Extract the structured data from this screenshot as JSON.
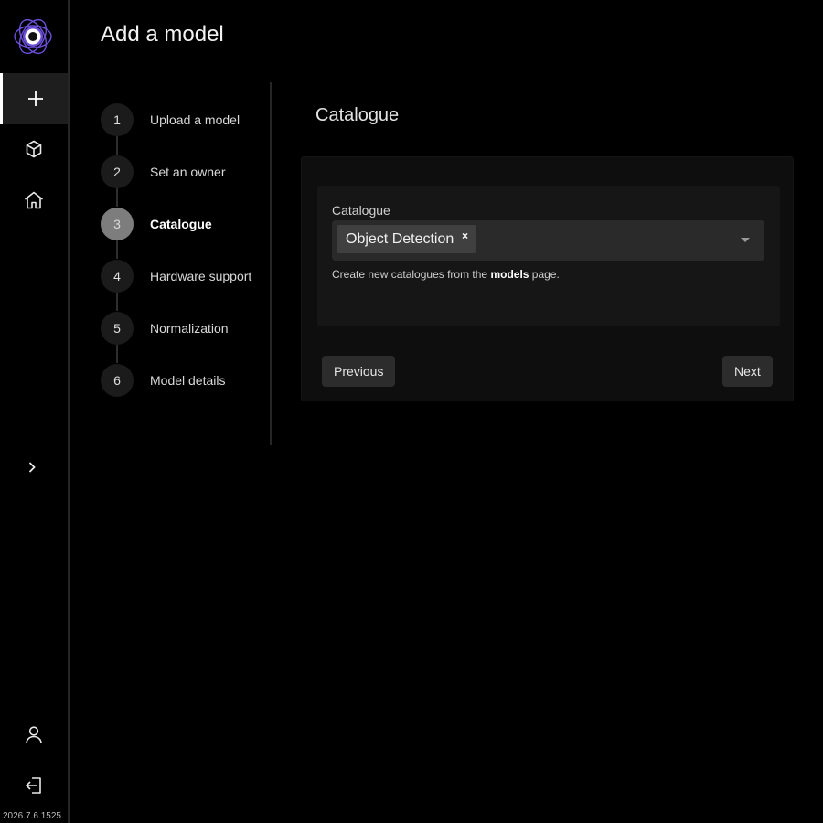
{
  "sidebar": {
    "nav": [
      {
        "icon": "plus-icon",
        "active": true
      },
      {
        "icon": "cube-icon",
        "active": false
      },
      {
        "icon": "home-icon",
        "active": false
      }
    ],
    "expand_icon": "chevron-right-icon",
    "profile_icon": "user-icon",
    "logout_icon": "logout-icon",
    "version": "2026.7.6.1525",
    "accent_color": "#6b4fd8"
  },
  "page": {
    "title": "Add a model"
  },
  "stepper": {
    "steps": [
      {
        "number": "1",
        "label": "Upload a model"
      },
      {
        "number": "2",
        "label": "Set an owner"
      },
      {
        "number": "3",
        "label": "Catalogue"
      },
      {
        "number": "4",
        "label": "Hardware support"
      },
      {
        "number": "5",
        "label": "Normalization"
      },
      {
        "number": "6",
        "label": "Model details"
      }
    ],
    "active_step": 3
  },
  "form": {
    "section_title": "Catalogue",
    "field_label": "Catalogue",
    "selected_values": [
      "Object Detection"
    ],
    "chip_remove": "×",
    "helper_prefix": "Create new catalogues from the ",
    "helper_link": "models",
    "helper_suffix": " page.",
    "previous_label": "Previous",
    "next_label": "Next"
  }
}
